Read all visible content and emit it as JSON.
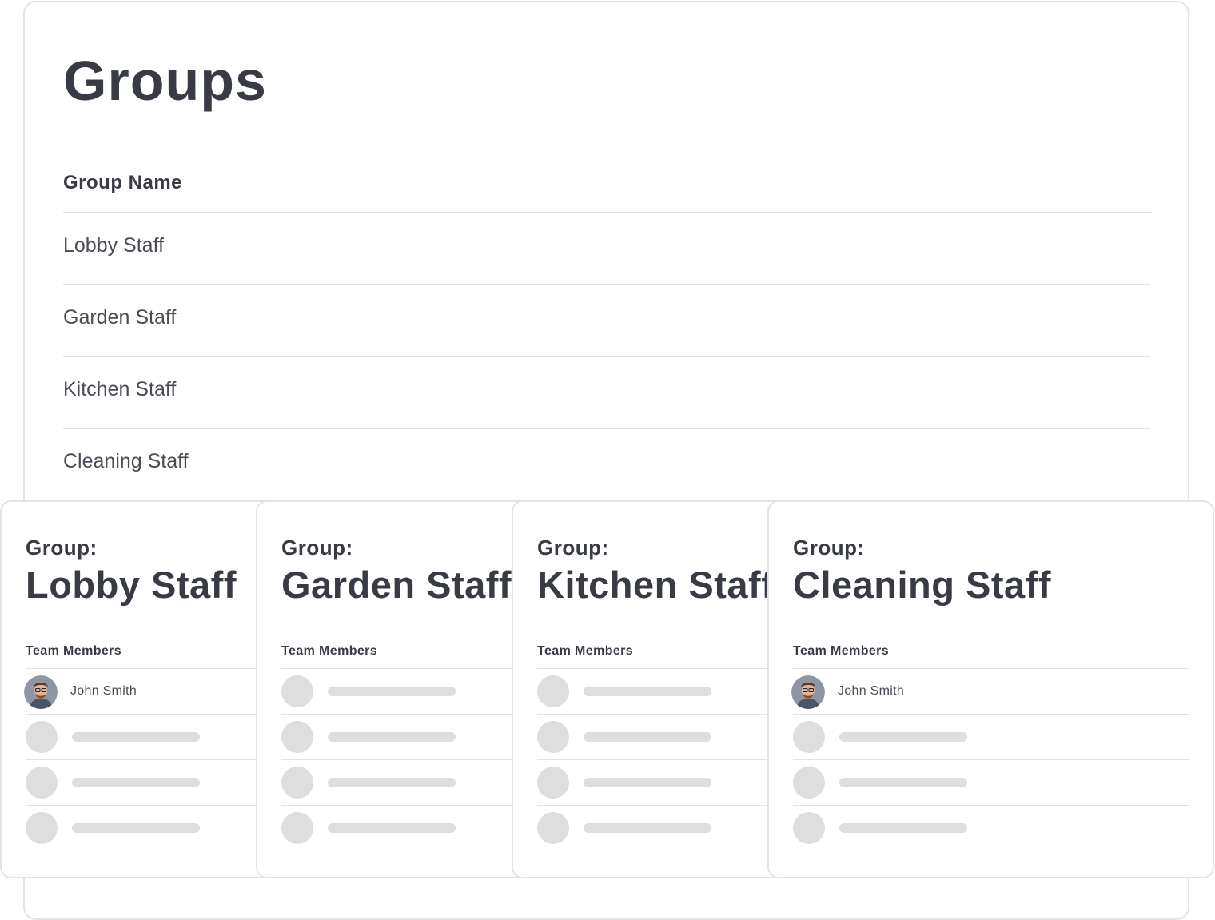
{
  "page": {
    "title": "Groups",
    "column_header": "Group Name"
  },
  "groups": [
    {
      "name": "Lobby Staff"
    },
    {
      "name": "Garden Staff"
    },
    {
      "name": "Kitchen Staff"
    },
    {
      "name": "Cleaning Staff"
    }
  ],
  "cards": [
    {
      "label": "Group:",
      "title": "Lobby Staff",
      "members_label": "Team Members",
      "member_name": "John Smith",
      "placeholders": 3
    },
    {
      "label": "Group:",
      "title": "Garden Staff",
      "members_label": "Team Members",
      "member_name": "",
      "placeholders": 4
    },
    {
      "label": "Group:",
      "title": "Kitchen Staff",
      "members_label": "Team Members",
      "member_name": "",
      "placeholders": 4
    },
    {
      "label": "Group:",
      "title": "Cleaning Staff",
      "members_label": "Team Members",
      "member_name": "John Smith",
      "placeholders": 3
    }
  ],
  "icons": {
    "member_avatar": "user-avatar-photo"
  },
  "colors": {
    "text": "#393b44",
    "border": "#e3e3e6",
    "placeholder": "#dedede"
  }
}
